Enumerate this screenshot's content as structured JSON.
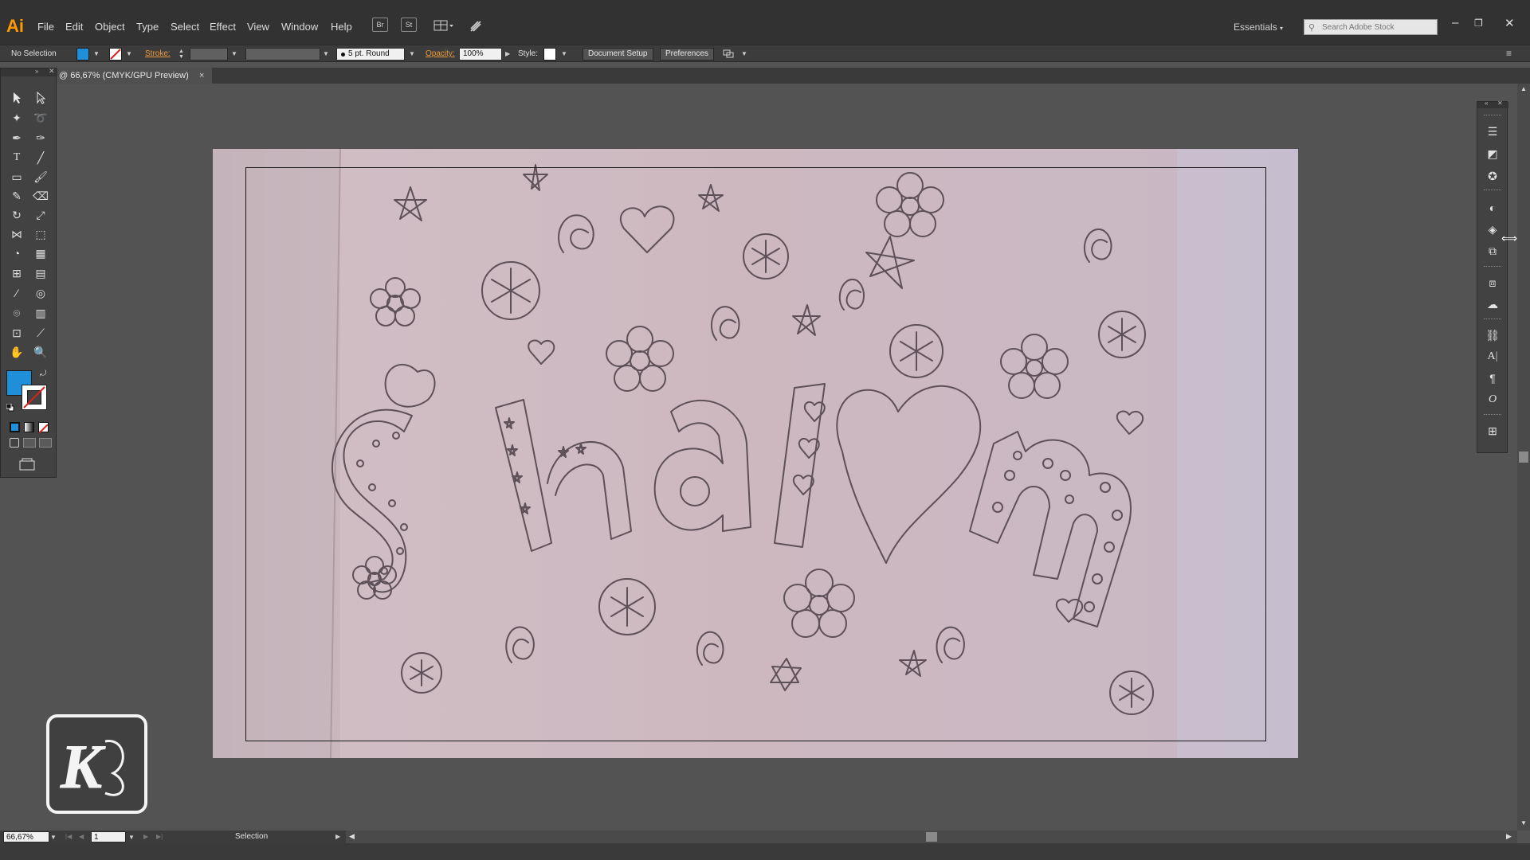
{
  "app": {
    "logo": "Ai",
    "menu": [
      "File",
      "Edit",
      "Object",
      "Type",
      "Select",
      "Effect",
      "View",
      "Window",
      "Help"
    ],
    "bridge_btn": "Br",
    "stock_btn": "St",
    "workspace": "Essentials",
    "search_placeholder": "Search Adobe Stock"
  },
  "control_bar": {
    "selection_label": "No Selection",
    "stroke_label": "Stroke:",
    "brush_label": "5 pt. Round",
    "opacity_label": "Opacity:",
    "opacity_value": "100%",
    "style_label": "Style:",
    "document_setup": "Document Setup",
    "preferences": "Preferences",
    "fill_color": "#1e8fd8"
  },
  "document": {
    "tab_title": "@ 66,67% (CMYK/GPU Preview)",
    "close_glyph": "×"
  },
  "status_bar": {
    "zoom": "66,67%",
    "artboard_number": "1",
    "tool_status": "Selection"
  },
  "artwork": {
    "lettering": "Shalom"
  },
  "watermark": {
    "letter": "K"
  },
  "colors": {
    "accent": "#ff9a00",
    "fill_swatch": "#1e8fd8",
    "paper": "#cdbac1"
  }
}
